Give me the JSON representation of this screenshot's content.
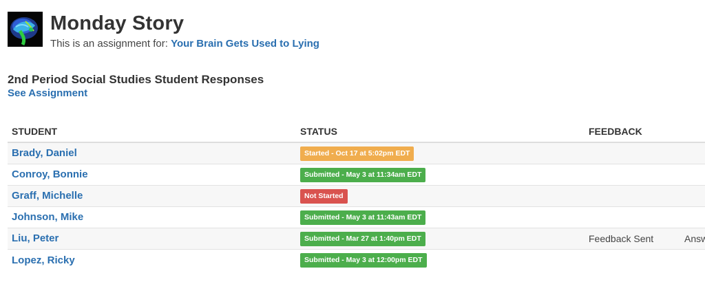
{
  "assignment": {
    "title": "Monday Story",
    "subtitle_prefix": "This is an assignment for:",
    "subtitle_link": "Your Brain Gets Used to Lying",
    "thumbnail_icon": "brain-scan-image"
  },
  "section": {
    "title": "2nd Period Social Studies Student Responses",
    "see_assignment": "See Assignment"
  },
  "table": {
    "headers": {
      "student": "STUDENT",
      "status": "STATUS",
      "feedback": "FEEDBACK"
    },
    "rows": [
      {
        "student": "Brady, Daniel",
        "status": "Started - Oct 17 at 5:02pm EDT",
        "status_type": "started",
        "feedback": "",
        "extra": ""
      },
      {
        "student": "Conroy, Bonnie",
        "status": "Submitted - May 3 at 11:34am EDT",
        "status_type": "submitted",
        "feedback": "",
        "extra": ""
      },
      {
        "student": "Graff, Michelle",
        "status": "Not Started",
        "status_type": "notstarted",
        "feedback": "",
        "extra": ""
      },
      {
        "student": "Johnson, Mike",
        "status": "Submitted - May 3 at 11:43am EDT",
        "status_type": "submitted",
        "feedback": "",
        "extra": ""
      },
      {
        "student": "Liu, Peter",
        "status": "Submitted - Mar 27 at 1:40pm EDT",
        "status_type": "submitted",
        "feedback": "Feedback Sent",
        "extra": "Answ"
      },
      {
        "student": "Lopez, Ricky",
        "status": "Submitted - May 3 at 12:00pm EDT",
        "status_type": "submitted",
        "feedback": "",
        "extra": ""
      }
    ]
  },
  "colors": {
    "link": "#2a6fb0",
    "started": "#f0ad4e",
    "submitted": "#4cae4c",
    "not_started": "#d9534f"
  }
}
